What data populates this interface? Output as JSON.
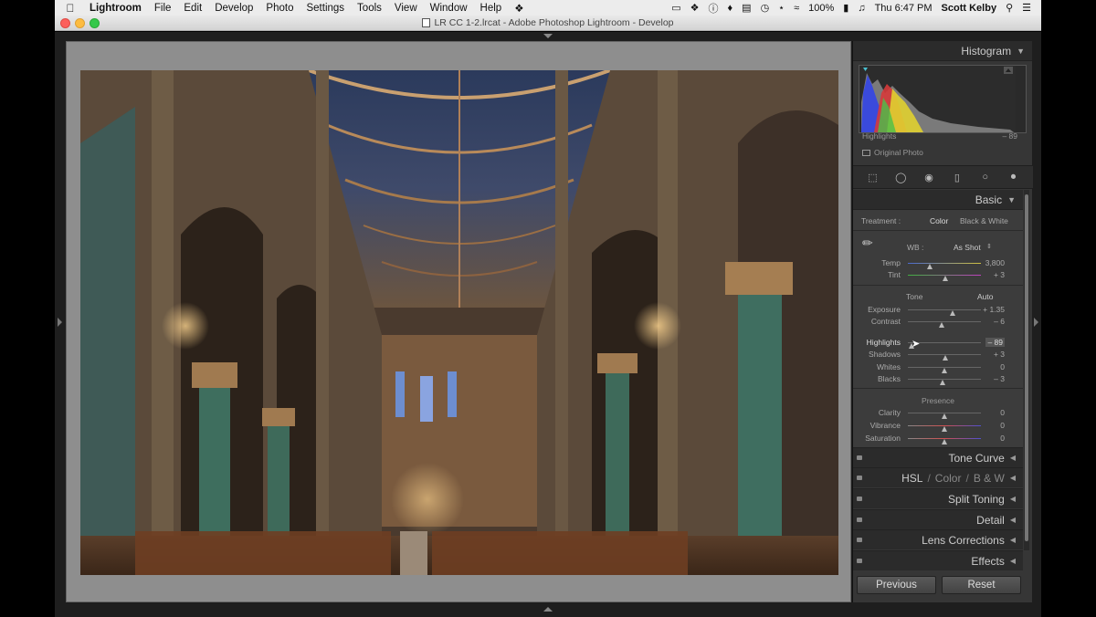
{
  "menubar": {
    "apple": "",
    "app_name": "Lightroom",
    "items": [
      "File",
      "Edit",
      "Develop",
      "Photo",
      "Settings",
      "Tools",
      "View",
      "Window",
      "Help"
    ],
    "battery": "100%",
    "clock": "Thu 6:47 PM",
    "user": "Scott Kelby"
  },
  "window": {
    "title": "LR CC 1-2.lrcat - Adobe Photoshop Lightroom - Develop"
  },
  "histogram": {
    "header": "Histogram",
    "readout_label": "Highlights",
    "readout_value": "– 89",
    "original_photo": "Original Photo"
  },
  "basic": {
    "header": "Basic",
    "treatment_label": "Treatment :",
    "treatment_color": "Color",
    "treatment_bw": "Black & White",
    "wb_label": "WB :",
    "wb_value": "As Shot",
    "tone_label": "Tone",
    "auto_label": "Auto",
    "presence_label": "Presence",
    "sliders": {
      "temp": {
        "label": "Temp",
        "value": "3,800",
        "pos": 0.3
      },
      "tint": {
        "label": "Tint",
        "value": "+ 3",
        "pos": 0.52
      },
      "exposure": {
        "label": "Exposure",
        "value": "+ 1.35",
        "pos": 0.62
      },
      "contrast": {
        "label": "Contrast",
        "value": "– 6",
        "pos": 0.47
      },
      "highlights": {
        "label": "Highlights",
        "value": "– 89",
        "pos": 0.05
      },
      "shadows": {
        "label": "Shadows",
        "value": "+ 3",
        "pos": 0.52
      },
      "whites": {
        "label": "Whites",
        "value": "0",
        "pos": 0.5
      },
      "blacks": {
        "label": "Blacks",
        "value": "– 3",
        "pos": 0.48
      },
      "clarity": {
        "label": "Clarity",
        "value": "0",
        "pos": 0.5
      },
      "vibrance": {
        "label": "Vibrance",
        "value": "0",
        "pos": 0.5
      },
      "saturation": {
        "label": "Saturation",
        "value": "0",
        "pos": 0.5
      }
    }
  },
  "panels": {
    "tone_curve": "Tone Curve",
    "hsl": "HSL",
    "color": "Color",
    "bw": "B & W",
    "split_toning": "Split Toning",
    "detail": "Detail",
    "lens_corrections": "Lens Corrections",
    "effects": "Effects"
  },
  "buttons": {
    "previous": "Previous",
    "reset": "Reset"
  }
}
